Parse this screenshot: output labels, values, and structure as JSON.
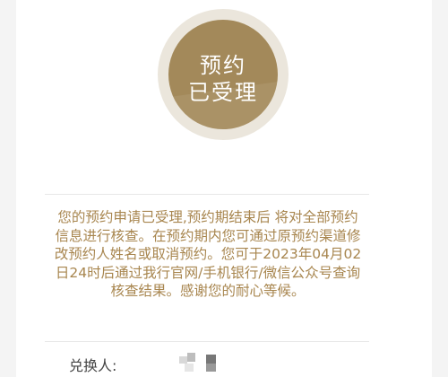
{
  "status_badge": {
    "line1": "预约",
    "line2": "已受理",
    "color": "#a3895a"
  },
  "message": "您的预约申请已受理,预约期结束后 将对全部预约信息进行核查。在预约期内您可通过原预约渠道修改预约人姓名或取消预约。您可于2023年04月02日24时后通过我行官网/手机银行/微信公众号查询核查结果。感谢您的耐心等候。",
  "message_color": "#a8864f",
  "details": {
    "exchanger_label": "兑换人:"
  }
}
